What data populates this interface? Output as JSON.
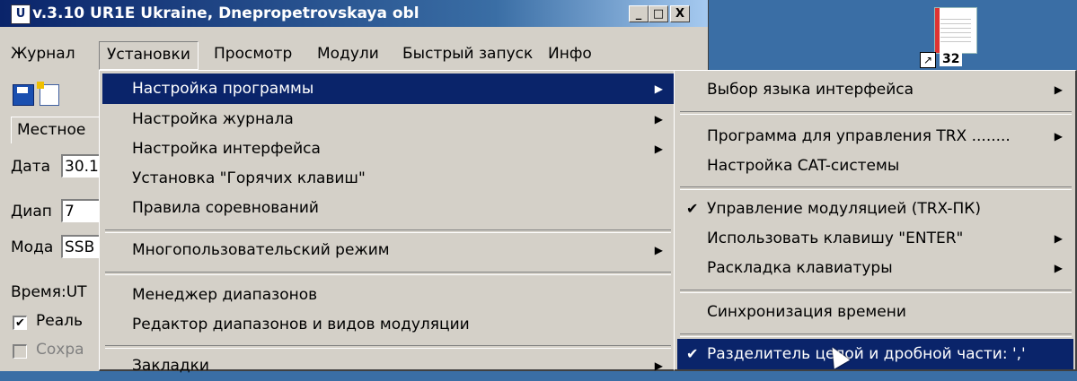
{
  "desktop": {
    "icon_label": "32"
  },
  "window": {
    "title": "v.3.10  UR1E Ukraine, Dnepropetrovskaya obl",
    "minimize": "_",
    "maximize": "□",
    "close": "X"
  },
  "menubar": [
    "Журнал",
    "Установки",
    "Просмотр",
    "Модули",
    "Быстрый запуск",
    "Инфо"
  ],
  "form": {
    "tab_label": "Местное",
    "date_label": "Дата",
    "date_value": "30.1",
    "band_label": "Диап",
    "band_value": "7",
    "mode_label": "Мода",
    "mode_value": "SSB",
    "time_label": "Время:UT",
    "realtime_label": "Реаль",
    "save_label": "Сохра"
  },
  "menu1": {
    "items": [
      {
        "label": "Настройка программы",
        "submenu": true
      },
      {
        "label": "Настройка журнала",
        "submenu": true
      },
      {
        "label": "Настройка интерфейса",
        "submenu": true
      },
      {
        "label": "Установка \"Горячих клавиш\""
      },
      {
        "label": "Правила соревнований"
      },
      {
        "label": "Многопользовательский режим",
        "submenu": true
      },
      {
        "label": "Менеджер диапазонов"
      },
      {
        "label": "Редактор диапазонов и видов модуляции"
      },
      {
        "label": "Закладки",
        "submenu": true
      }
    ]
  },
  "menu2": {
    "items": [
      {
        "label": "Выбор языка интерфейса",
        "submenu": true
      },
      {
        "label": "Программа для управления TRX ........",
        "submenu": true
      },
      {
        "label": "Настройка CAT-системы"
      },
      {
        "label": "Управление модуляцией (TRX-ПК)",
        "checked": true
      },
      {
        "label": "Использовать клавишу \"ENTER\"",
        "submenu": true
      },
      {
        "label": "Раскладка клавиатуры",
        "submenu": true
      },
      {
        "label": "Синхронизация времени"
      },
      {
        "label": "Разделитель целой и дробной части: ','",
        "checked": true
      }
    ]
  },
  "glyphs": {
    "submenu_arrow": "▶",
    "check": "✔"
  }
}
